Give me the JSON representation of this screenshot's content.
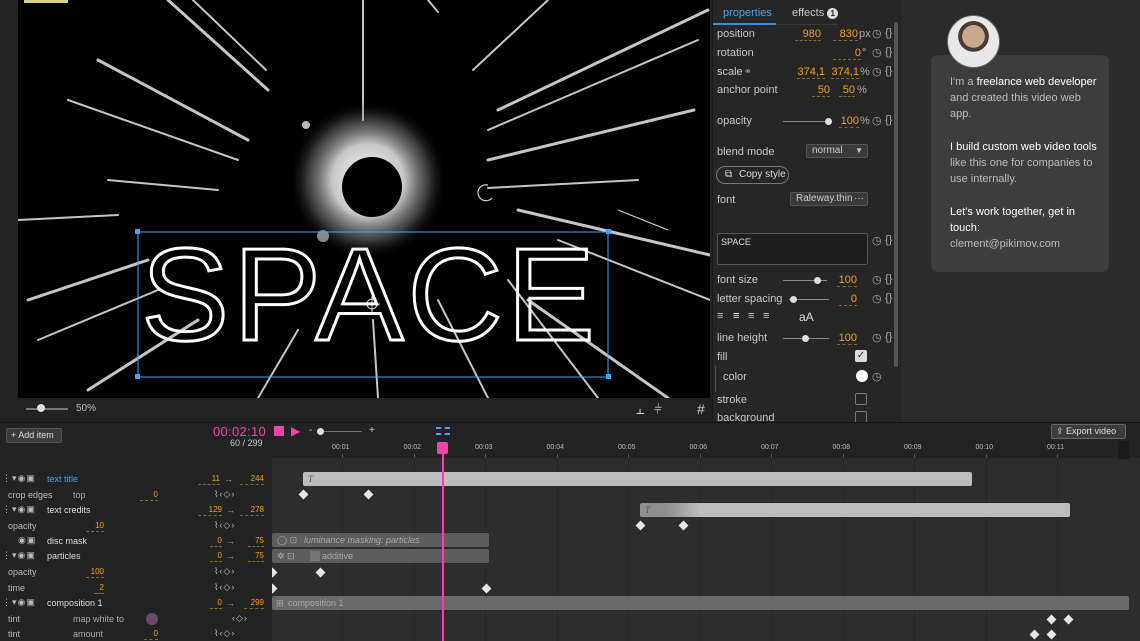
{
  "viewer": {
    "title_text": "SPACE",
    "zoom_label": "50%"
  },
  "properties": {
    "tabs": [
      {
        "label": "properties"
      },
      {
        "label": "effects",
        "badge": "1"
      }
    ],
    "rows": {
      "position": {
        "label": "position",
        "x": "980",
        "y": "830",
        "unit": "px"
      },
      "rotation": {
        "label": "rotation",
        "value": "0",
        "unit": "°"
      },
      "scale": {
        "label": "scale",
        "x": "374,1",
        "y": "374,1",
        "unit": "%"
      },
      "anchor": {
        "label": "anchor point",
        "x": "50",
        "y": "50",
        "unit": "%"
      },
      "opacity": {
        "label": "opacity",
        "value": "100",
        "unit": "%"
      },
      "blend": {
        "label": "blend mode",
        "value": "normal"
      },
      "copy_style": "Copy style",
      "font": {
        "label": "font",
        "value": "Raleway.thin",
        "more": "···"
      },
      "text": {
        "value": "SPACE"
      },
      "font_size": {
        "label": "font size",
        "value": "100"
      },
      "letter_spacing": {
        "label": "letter spacing",
        "value": "0"
      },
      "aa": "aA",
      "line_height": {
        "label": "line height",
        "value": "100"
      },
      "fill": {
        "label": "fill"
      },
      "color": {
        "label": "color"
      },
      "stroke": {
        "label": "stroke"
      },
      "background": {
        "label": "background"
      }
    }
  },
  "promo": {
    "p1_pre": "I'm a ",
    "p1_bold": "freelance web developer",
    "p1_post": " and created this video web app.",
    "p2_bold": "I build custom web video tools",
    "p2_post": " like this one for companies to use internally.",
    "p3_bold": "Let's work together, get in touch:",
    "p3_email": "clement@pikimov.com"
  },
  "timeline": {
    "add_item": "Add item",
    "timecode": "00:02:10",
    "frames": "60 / 299",
    "export": "Export video",
    "ruler": [
      "00:01",
      "00:02",
      "00:03",
      "00:04",
      "00:05",
      "00:06",
      "00:07",
      "00:08",
      "00:09",
      "00:10",
      "00:11"
    ],
    "layers": [
      {
        "name": "text title",
        "start": "11",
        "end": "244"
      },
      {
        "prop": "crop edges",
        "sub": "top",
        "value": "0"
      },
      {
        "name": "text credits",
        "start": "129",
        "end": "278"
      },
      {
        "prop": "opacity",
        "value": "10"
      },
      {
        "name": "disc mask",
        "start": "0",
        "end": "75"
      },
      {
        "name": "particles",
        "start": "0",
        "end": "75"
      },
      {
        "prop": "opacity",
        "value": "100"
      },
      {
        "prop": "time",
        "value": "2"
      },
      {
        "name": "composition 1",
        "start": "0",
        "end": "299"
      },
      {
        "prop": "tint",
        "sub": "map white to"
      },
      {
        "prop": "tint",
        "sub": "amount",
        "value": "0"
      }
    ],
    "clips": {
      "mask_label": "luminance masking: particles",
      "particles_label": "additive",
      "comp_label": "composition 1",
      "text_icon": "T"
    }
  }
}
